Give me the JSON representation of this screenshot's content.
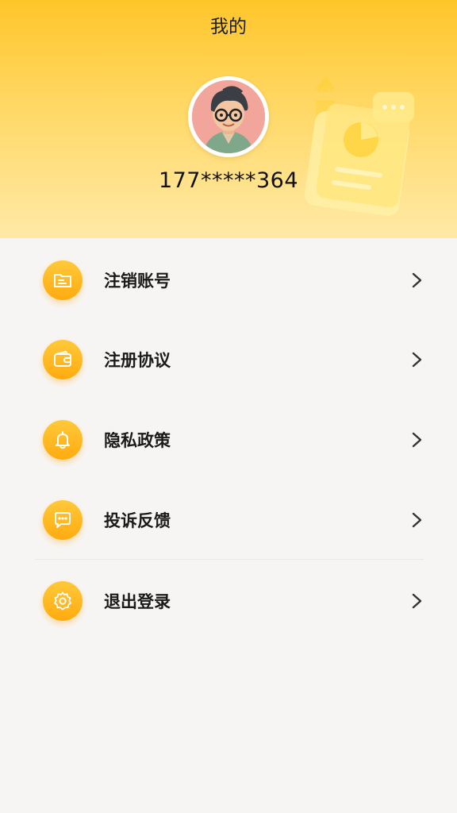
{
  "header": {
    "title": "我的",
    "phone": "177*****364"
  },
  "menu": {
    "items": [
      {
        "label": "注销账号",
        "icon": "id-card-icon"
      },
      {
        "label": "注册协议",
        "icon": "wallet-icon"
      },
      {
        "label": "隐私政策",
        "icon": "bell-icon"
      },
      {
        "label": "投诉反馈",
        "icon": "chat-bubble-icon"
      },
      {
        "label": "退出登录",
        "icon": "gear-icon"
      }
    ]
  },
  "colors": {
    "header_top": "#ffc62a",
    "header_bottom": "#ffe9a6",
    "icon_accent": "#ffab0f",
    "background": "#f7f5f4"
  }
}
